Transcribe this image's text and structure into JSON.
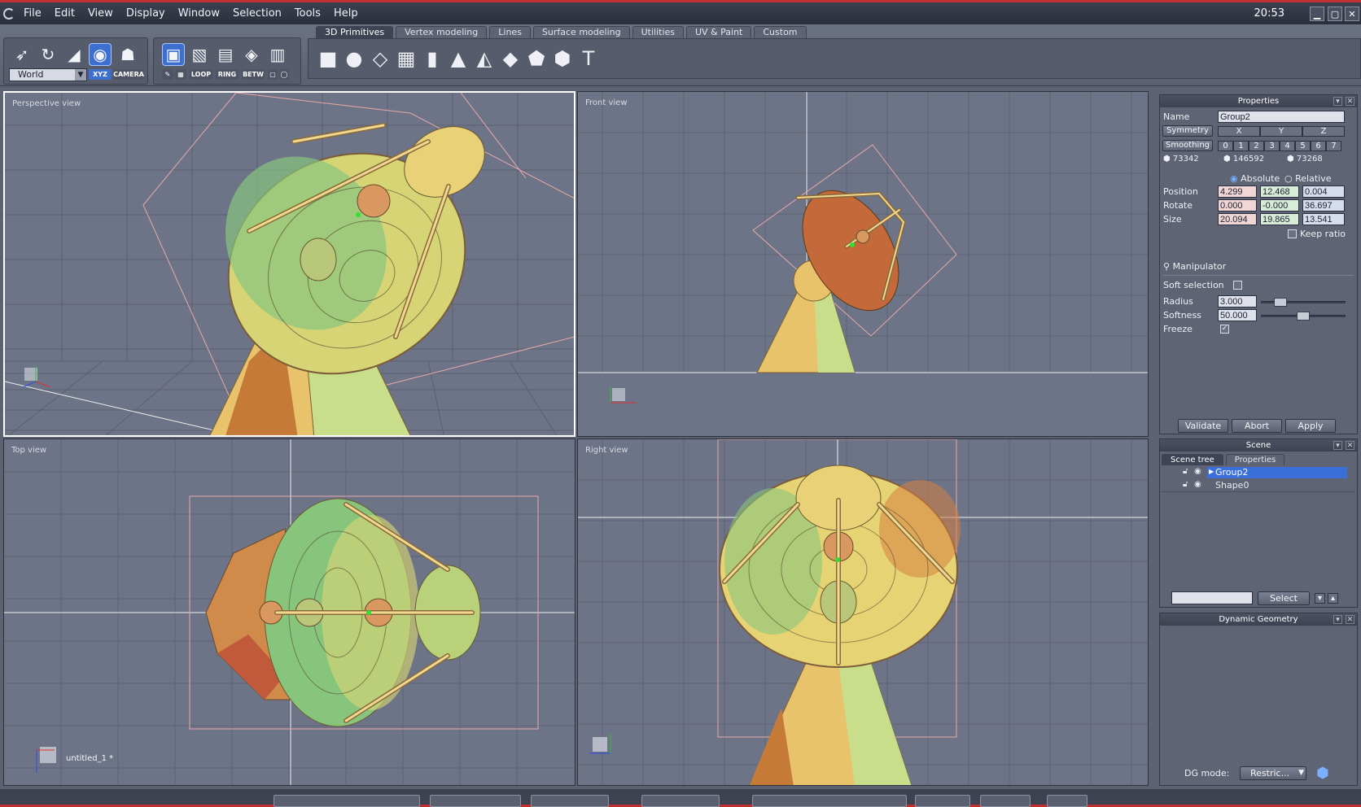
{
  "menubar": {
    "items": [
      "File",
      "Edit",
      "View",
      "Display",
      "Window",
      "Selection",
      "Tools",
      "Help"
    ],
    "clock": "20:53",
    "window_controls": [
      "minimize-icon",
      "maximize-icon",
      "close-icon"
    ]
  },
  "toolbar": {
    "coord_space": "World",
    "xyz_label": "XYZ",
    "camera_label": "CAMERA",
    "select_mode_tags": [
      "LOOP",
      "RING",
      "BETW"
    ],
    "tabs": [
      "3D Primitives",
      "Vertex modeling",
      "Lines",
      "Surface modeling",
      "Utilities",
      "UV & Paint",
      "Custom"
    ],
    "active_tab": "3D Primitives",
    "primitives": [
      "cube-icon",
      "sphere-icon",
      "plane-icon",
      "grid-plane-icon",
      "cylinder-icon",
      "cone-icon",
      "pyramid-icon",
      "diamond-icon",
      "dodecahedron-icon",
      "geosphere-icon",
      "text-icon"
    ]
  },
  "viewports": {
    "perspective": "Perspective view",
    "front": "Front view",
    "top": "Top view",
    "right": "Right view",
    "file_label": "untitled_1",
    "file_modified": "*"
  },
  "properties": {
    "title": "Properties",
    "name_label": "Name",
    "name_value": "Group2",
    "symmetry_label": "Symmetry",
    "symmetry_axes": [
      "X",
      "Y",
      "Z"
    ],
    "smoothing_label": "Smoothing",
    "smoothing_levels": [
      "0",
      "1",
      "2",
      "3",
      "4",
      "5",
      "6",
      "7"
    ],
    "counts": [
      "73342",
      "146592",
      "73268"
    ],
    "absolute_label": "Absolute",
    "relative_label": "Relative",
    "position_label": "Position",
    "position": [
      "4.299",
      "12.468",
      "0.004"
    ],
    "rotate_label": "Rotate",
    "rotate": [
      "0.000",
      "-0.000",
      "36.697"
    ],
    "size_label": "Size",
    "size": [
      "20.094",
      "19.865",
      "13.541"
    ],
    "keep_ratio_label": "Keep ratio",
    "manipulator_label": "Manipulator",
    "soft_selection_label": "Soft selection",
    "radius_label": "Radius",
    "radius_value": "3.000",
    "radius_level": 0.18,
    "softness_label": "Softness",
    "softness_value": "50.000",
    "softness_level": 0.5,
    "freeze_label": "Freeze",
    "freeze_checked": "✓",
    "validate_label": "Validate",
    "abort_label": "Abort",
    "apply_label": "Apply"
  },
  "scene": {
    "title": "Scene",
    "tabs": [
      "Scene tree",
      "Properties"
    ],
    "items": [
      "Group2",
      "Shape0"
    ],
    "selected": "Group2",
    "select_label": "Select"
  },
  "dynamic_geometry": {
    "title": "Dynamic Geometry",
    "dg_mode_label": "DG mode:",
    "dg_mode_value": "Restric..."
  },
  "colors": {
    "accent": "#3c6fd0",
    "background": "#6d7487",
    "selection_box": "#e8a8a8",
    "title_bar_border": "#c03030"
  }
}
